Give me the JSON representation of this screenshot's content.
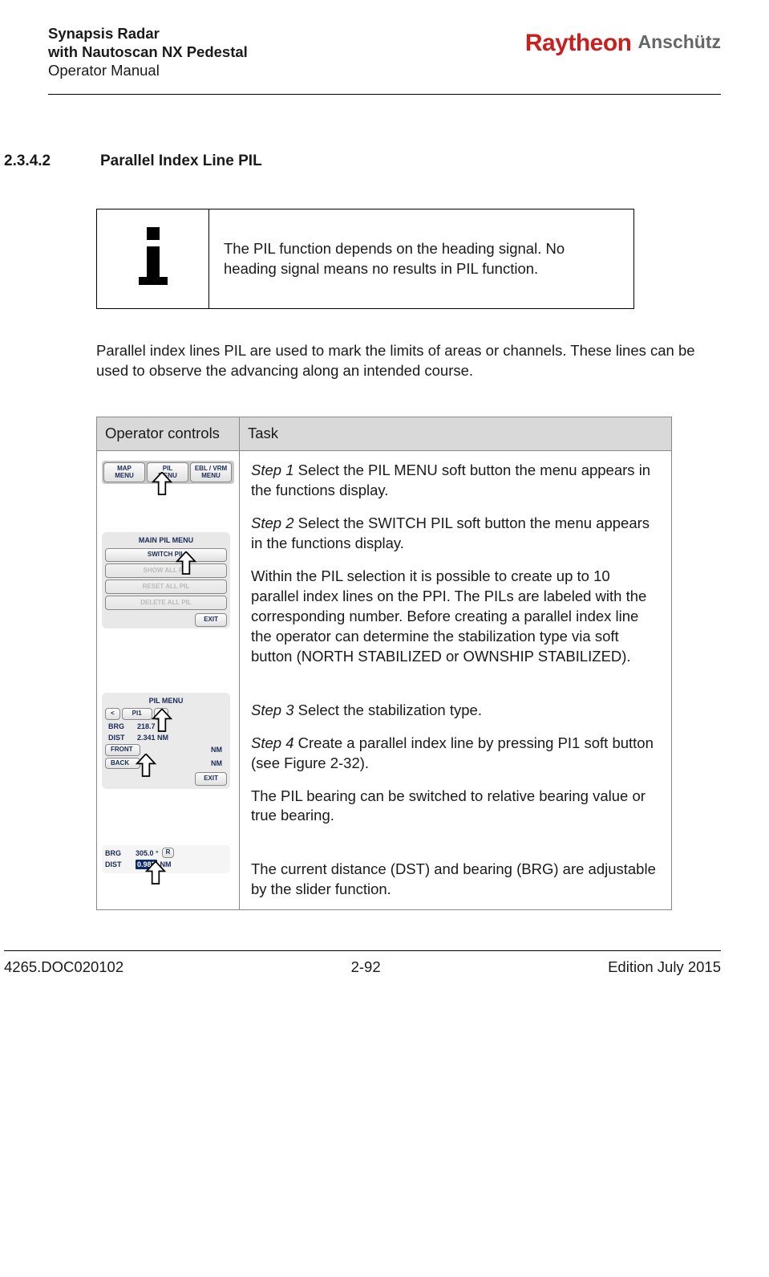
{
  "header": {
    "line1": "Synapsis Radar",
    "line2": "with Nautoscan NX Pedestal",
    "line3": "Operator Manual",
    "logo_primary": "Raytheon",
    "logo_secondary": "Anschütz"
  },
  "section": {
    "number": "2.3.4.2",
    "title": "Parallel Index Line PIL"
  },
  "info_note": "The PIL function depends on the heading signal. No heading signal means no results in PIL function.",
  "intro": "Parallel index lines PIL are used to mark the limits of areas or channels. These lines can be used to observe the advancing along an intended course.",
  "table_headers": {
    "col1": "Operator controls",
    "col2": "Task"
  },
  "soft_buttons": {
    "map_menu": "MAP\nMENU",
    "pil_menu": "PIL\nMENU",
    "ebl_vrm_menu": "EBL / VRM\nMENU"
  },
  "main_pil_menu": {
    "title": "MAIN PIL MENU",
    "btn_switch": "SWITCH PIL",
    "btn_showall": "SHOW ALL PIL",
    "btn_resetall": "RESET ALL PIL",
    "btn_deleteall": "DELETE ALL PIL",
    "btn_exit": "EXIT"
  },
  "pil_menu": {
    "title": "PIL MENU",
    "pi_lt": "<",
    "pi1": "PI1",
    "pi_gt": ">",
    "brg_label": "BRG",
    "brg_val": "218.7",
    "dist_label": "DIST",
    "dist_val": "2.341 NM",
    "front": "FRONT",
    "front_val": "NM",
    "back": "BACK",
    "back_val": "NM",
    "exit": "EXIT"
  },
  "brg_block": {
    "brg_label": "BRG",
    "brg_val": "305.0 °",
    "brg_mode": "R",
    "dist_label": "DIST",
    "dist_slider": "0.981",
    "dist_unit": "NM"
  },
  "task": {
    "step1": "Select the PIL MENU soft button the menu appears in the functions display.",
    "step2": "Select the SWITCH PIL soft button the menu appears in the functions display.",
    "para1": "Within the PIL selection it is possible to create up to 10 parallel index lines on the PPI. The PILs are labeled with the corresponding number. Before creating a parallel index line the operator can determine the stabilization type via soft button (NORTH STABILIZED or OWNSHIP STABILIZED).",
    "step3": "Select the stabilization type.",
    "step4": "Create a parallel index line by pressing PI1 soft button (see Figure 2-32).",
    "para2": "The PIL bearing can be switched to relative bearing value or true bearing.",
    "para3": "The current distance (DST) and bearing (BRG) are adjustable by the slider function."
  },
  "step_labels": {
    "s1": "Step 1",
    "s2": "Step 2",
    "s3": "Step 3",
    "s4": "Step 4"
  },
  "footer": {
    "doc": "4265.DOC020102",
    "page": "2-92",
    "edition": "Edition July 2015"
  }
}
